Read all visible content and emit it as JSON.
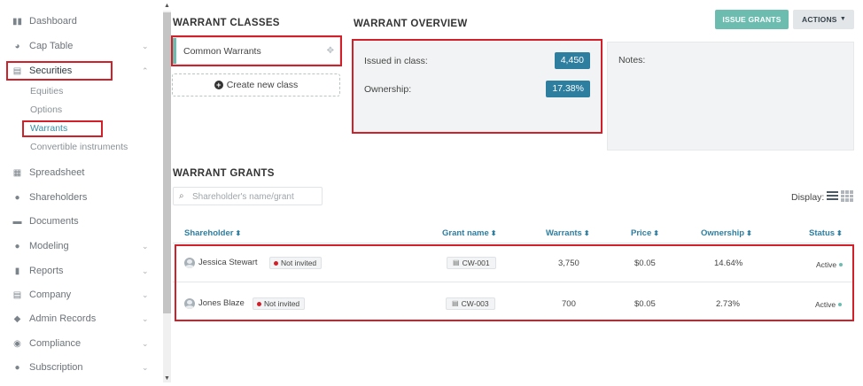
{
  "sidebar": {
    "items": [
      {
        "label": "Dashboard",
        "icon": "dashboard-icon",
        "glyph": "▮▮"
      },
      {
        "label": "Cap Table",
        "icon": "pie-chart-icon",
        "glyph": "◕"
      },
      {
        "label": "Securities",
        "icon": "clipboard-icon",
        "glyph": "▤"
      },
      {
        "label": "Spreadsheet",
        "icon": "spreadsheet-icon",
        "glyph": "▦"
      },
      {
        "label": "Shareholders",
        "icon": "person-icon",
        "glyph": "●"
      },
      {
        "label": "Documents",
        "icon": "folder-icon",
        "glyph": "▬"
      },
      {
        "label": "Modeling",
        "icon": "lightbulb-icon",
        "glyph": "●"
      },
      {
        "label": "Reports",
        "icon": "reports-icon",
        "glyph": "▮"
      },
      {
        "label": "Company",
        "icon": "building-icon",
        "glyph": "▤"
      },
      {
        "label": "Admin Records",
        "icon": "admin-records-icon",
        "glyph": "◆"
      },
      {
        "label": "Compliance",
        "icon": "shield-check-icon",
        "glyph": "◉"
      },
      {
        "label": "Subscription",
        "icon": "dollar-circle-icon",
        "glyph": "●"
      }
    ],
    "securities_sub": [
      "Equities",
      "Options",
      "Warrants",
      "Convertible instruments"
    ]
  },
  "classes": {
    "title": "WARRANT CLASSES",
    "items": [
      "Common Warrants"
    ],
    "create_label": "Create new class"
  },
  "overview": {
    "title": "WARRANT OVERVIEW",
    "issued_label": "Issued in class:",
    "issued_value": "4,450",
    "ownership_label": "Ownership:",
    "ownership_value": "17.38%"
  },
  "notes": {
    "label": "Notes:"
  },
  "toolbar": {
    "issue_label": "ISSUE GRANTS",
    "actions_label": "ACTIONS"
  },
  "grants": {
    "title": "WARRANT GRANTS",
    "search_placeholder": "Shareholder's name/grant",
    "display_label": "Display:",
    "columns": [
      "Shareholder",
      "Grant name",
      "Warrants",
      "Price",
      "Ownership",
      "Status"
    ],
    "rows": [
      {
        "name": "Jessica Stewart",
        "invite": "Not invited",
        "grant": "CW-001",
        "warrants": "3,750",
        "price": "$0.05",
        "ownership": "14.64%",
        "status": "Active"
      },
      {
        "name": "Jones Blaze",
        "invite": "Not invited",
        "grant": "CW-003",
        "warrants": "700",
        "price": "$0.05",
        "ownership": "2.73%",
        "status": "Active"
      }
    ]
  },
  "colors": {
    "accent": "#6dbcb0",
    "primary": "#2e7ea0",
    "highlight": "#d1202a"
  }
}
